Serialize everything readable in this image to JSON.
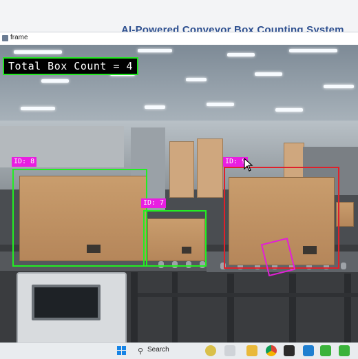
{
  "background": {
    "heading": "AI-Powered Conveyor Box Counting System"
  },
  "window": {
    "title": "frame",
    "icon": "app-window-icon"
  },
  "overlay": {
    "count_text": "Total Box Count = 4",
    "detections": [
      {
        "id_label": "ID: 8",
        "status": "counted",
        "color": "#22ee22"
      },
      {
        "id_label": "ID: 7",
        "status": "counted",
        "color": "#22ee22"
      },
      {
        "id_label": "ID: 9",
        "status": "tracking",
        "color": "#e0202a"
      },
      {
        "id_label": "",
        "status": "new-detection",
        "color": "#e21fd6"
      }
    ]
  },
  "taskbar": {
    "search_label": "Search",
    "apps": [
      "windows-start-icon",
      "search-icon",
      "file-explorer-icon",
      "chrome-icon",
      "terminal-icon",
      "vscode-icon",
      "app-green-icon",
      "app-green-2-icon"
    ]
  },
  "colors": {
    "count_border": "#22e522",
    "tag_bg": "#e91ee1",
    "accent_blue": "#2d4f8f"
  }
}
